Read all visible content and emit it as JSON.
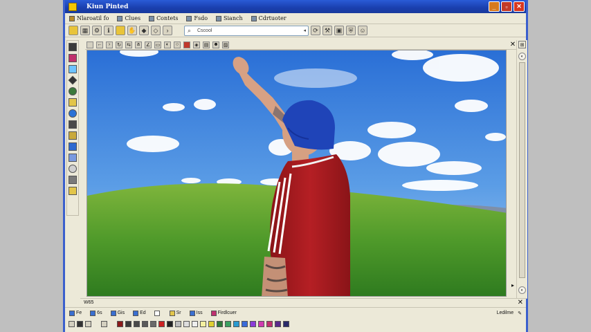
{
  "window": {
    "title": "Kiun Pinted",
    "buttons": {
      "minimize": "_",
      "maximize": "▫",
      "close": "✕"
    }
  },
  "menubar": {
    "items": [
      {
        "label": "Nlaroatil fo",
        "icon": "file-icon"
      },
      {
        "label": "Clues",
        "icon": "edit-icon"
      },
      {
        "label": "Contets",
        "icon": "view-icon"
      },
      {
        "label": "Fsdo",
        "icon": "image-icon"
      },
      {
        "label": "Sianch",
        "icon": "colors-icon"
      },
      {
        "label": "Cdrtuoter",
        "icon": "help-icon"
      }
    ]
  },
  "toolbar": {
    "search_value": "Cscool",
    "search_arrow": "◂"
  },
  "statusline": {
    "text": "W65",
    "close": "✕"
  },
  "bottombar": {
    "items": [
      {
        "label": "Fe"
      },
      {
        "label": "6s"
      },
      {
        "label": "Gis"
      },
      {
        "label": "Ed"
      },
      {
        "label": ""
      },
      {
        "label": "Sr"
      },
      {
        "label": "Iss"
      },
      {
        "label": "Firdlcuer"
      }
    ],
    "right_label": "Ledilme",
    "right_icon": "pencil-icon"
  },
  "palette": {
    "colors": [
      "#8b1a1a",
      "#3a3a3a",
      "#4a4a4a",
      "#5a5a5a",
      "#6a6a6a",
      "#cc2222",
      "#222222",
      "#bbbbbb",
      "#dddddd",
      "#eeeeee",
      "#f4f0a0",
      "#e0d030",
      "#2f7a3a",
      "#3aa060",
      "#2a9ad0",
      "#3a6ad8",
      "#8a3ad8",
      "#d03ab0",
      "#c03070",
      "#5a2a8a",
      "#2a2a6a"
    ]
  }
}
